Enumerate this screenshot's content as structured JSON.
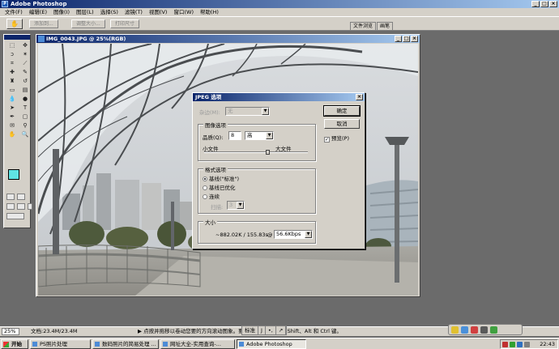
{
  "app": {
    "title": "Adobe Photoshop"
  },
  "menu": [
    "文件(F)",
    "编辑(E)",
    "图像(I)",
    "图层(L)",
    "选择(S)",
    "滤镜(T)",
    "视图(V)",
    "窗口(W)",
    "帮助(H)"
  ],
  "options_bar": {
    "buttons": [
      "添加到...",
      "调整大小...",
      "打印尺寸"
    ],
    "palette_well_tabs": [
      "文件浏览",
      "画笔"
    ]
  },
  "document": {
    "title": "IMG_0043.JPG @ 25%(RGB)"
  },
  "toolbox": {
    "foreground_color": "#5fe3e3",
    "background_color": "#ffffff"
  },
  "dialog": {
    "title": "JPEG 选项",
    "matte_label": "杂边(M):",
    "matte_value": "无",
    "image_options_title": "图像选项",
    "quality_label": "品质(Q):",
    "quality_value": "8",
    "quality_preset": "高",
    "small_file": "小文件",
    "large_file": "大文件",
    "quality_slider_fraction": 0.62,
    "format_options_title": "格式选项",
    "format_options": [
      "基线(\"标准\")",
      "基线已优化",
      "连续"
    ],
    "format_selected": 0,
    "scans_label": "扫描:",
    "scans_value": "3",
    "size_title": "大小",
    "size_text": "~882.02K / 155.83s",
    "at_label": "@",
    "speed_value": "56.6Kbps",
    "ok_label": "确定",
    "cancel_label": "取消",
    "preview_label": "预览(P)",
    "preview_checked": true
  },
  "statusbar": {
    "zoom": "25%",
    "doc_info": "文档:23.4M/23.4M",
    "hint": "点按并拖移以卷动您要的方向滚动图象。要用附加选项，使用 Shift、Alt 和 Ctrl 键。"
  },
  "ime": [
    "标准",
    "J",
    "•,",
    "↗"
  ],
  "taskbar": {
    "start_label": "开始",
    "tasks": [
      {
        "label": "PS照片处理",
        "active": false
      },
      {
        "label": "数码照片的简易处理 ...",
        "active": false
      },
      {
        "label": "网址大全-实用查询-...",
        "active": false
      },
      {
        "label": "Adobe Photoshop",
        "active": true
      }
    ],
    "clock": "22:43"
  }
}
